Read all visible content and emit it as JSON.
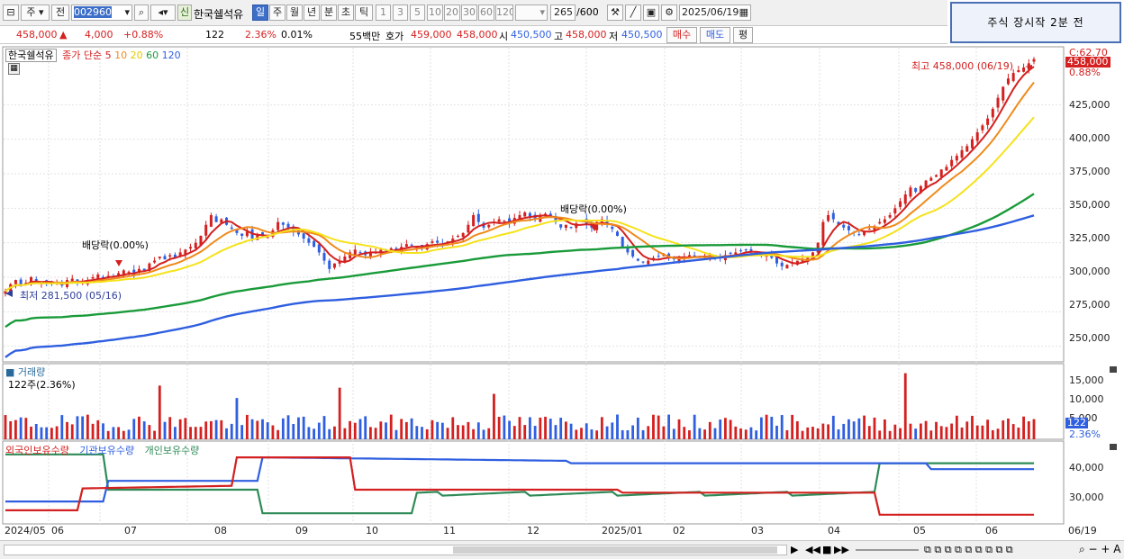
{
  "toolbar": {
    "type_label": "주",
    "jeon_label": "전",
    "code": "002960",
    "shin_badge": "신",
    "stock_name": "한국쉘석유",
    "periods": [
      "일",
      "주",
      "월",
      "년",
      "분",
      "초",
      "틱"
    ],
    "period_active": "일",
    "minute_steps": [
      "1",
      "3",
      "5",
      "10",
      "20",
      "30",
      "60",
      "120"
    ],
    "count": "265",
    "count_total": "/600",
    "date": "2025/06/19"
  },
  "notice": {
    "text": "주식 장시작  2분 전"
  },
  "quote": {
    "price": "458,000",
    "change_arrow": "▲",
    "change": "4,000",
    "change_pct": "+0.88%",
    "volume": "122",
    "volume_ratio": "2.36%",
    "turnover": "0.01%",
    "amount": "55백만",
    "hoga_label": "호가",
    "ask": "459,000",
    "bid": "458,000",
    "open_label": "시",
    "open": "450,500",
    "high_label": "고",
    "high": "458,000",
    "low_label": "저",
    "low": "450,500",
    "buy_label": "매수",
    "sell_label": "매도",
    "eval_label": "평"
  },
  "price_panel": {
    "legend_name": "한국쉘석유",
    "legend_ma": "종가 단순",
    "ma_periods": [
      "5",
      "10",
      "20",
      "60",
      "120"
    ],
    "ma_colors": [
      "#d42020",
      "#f08a1c",
      "#f5e21b",
      "#1a9b3a",
      "#2f5fe0"
    ],
    "yticks": [
      "425,000",
      "400,000",
      "375,000",
      "350,000",
      "325,000",
      "300,000",
      "275,000",
      "250,000"
    ],
    "last_price_box": "458,000",
    "last_pct_label": "0.88%",
    "top_label": "C:62.70",
    "high_annotation": "최고 458,000 (06/19)",
    "low_annotation": "최저 281,500 (05/16)",
    "dividend1": "배당락(0.00%)",
    "dividend2": "배당락(0.00%)"
  },
  "volume_panel": {
    "title": "거래량",
    "sub": "122주(2.36%)",
    "yticks": [
      "15,000",
      "10,000",
      "5,000"
    ],
    "last_box": "122",
    "last_pct": "2.36%"
  },
  "holding_panel": {
    "titles": [
      "외국인보유수량",
      "기관보유수량",
      "개인보유수량"
    ],
    "colors": [
      "#d42020",
      "#2f5fe0",
      "#2e8b57"
    ],
    "yticks": [
      "40,000",
      "30,000"
    ]
  },
  "xaxis": [
    "2024/05",
    "06",
    "07",
    "08",
    "09",
    "10",
    "11",
    "12",
    "2025/01",
    "02",
    "03",
    "04",
    "05",
    "06",
    "06/19"
  ],
  "chart_data": {
    "type": "line",
    "ylim": [
      240000,
      465000
    ],
    "high_point": {
      "date": "06/19",
      "value": 458000
    },
    "low_point": {
      "date": "05/16",
      "value": 281500
    },
    "close_series": [
      {
        "month": "2024/05",
        "values": [
          290000,
          295000,
          298000,
          294000,
          296000,
          300000,
          297000,
          296000,
          295000
        ]
      },
      {
        "month": "06",
        "values": [
          295000,
          296000,
          294000,
          298000,
          299000,
          297000,
          296000,
          298000,
          300000,
          302000,
          299000,
          301000,
          300000,
          303000,
          305000,
          304000
        ]
      },
      {
        "month": "07",
        "values": [
          302000,
          306000,
          305000,
          310000,
          312000,
          315000,
          313000,
          316000,
          314000,
          318000,
          320000,
          322000,
          325000,
          330000,
          338000,
          345000,
          340000
        ]
      },
      {
        "month": "08",
        "values": [
          342000,
          338000,
          335000,
          332000,
          330000,
          333000,
          328000,
          331000,
          330000,
          329000,
          334000,
          340000,
          338000,
          336000,
          333000,
          331000,
          328000
        ]
      },
      {
        "month": "09",
        "values": [
          325000,
          322000,
          318000,
          312000,
          306000,
          310000,
          312000,
          315000,
          318000,
          320000,
          318000,
          316000,
          318000
        ]
      },
      {
        "month": "10",
        "values": [
          318000,
          320000,
          319000,
          321000,
          320000,
          322000,
          324000,
          323000,
          322000,
          321000,
          324000,
          326000,
          325000,
          324000,
          326000,
          328000,
          330000
        ]
      },
      {
        "month": "11",
        "values": [
          332000,
          338000,
          345000,
          340000,
          336000,
          338000,
          340000,
          342000,
          341000,
          339000,
          343000,
          345000,
          347000,
          344000,
          342000,
          345000,
          346000
        ]
      },
      {
        "month": "12",
        "values": [
          344000,
          340000,
          336000,
          338000,
          336000,
          339000,
          341000,
          338000,
          336000,
          340000,
          342000,
          338000,
          335000
        ]
      },
      {
        "month": "2025/01",
        "values": [
          330000,
          322000,
          318000,
          315000,
          312000,
          311000,
          312000,
          314000,
          315000,
          316000,
          314000,
          313000,
          314000,
          315000,
          316000,
          315000
        ]
      },
      {
        "month": "02",
        "values": [
          314000,
          315000,
          316000,
          315000,
          314000,
          316000,
          317000,
          318000,
          319000,
          320000,
          318000,
          317000,
          316000,
          318000
        ]
      },
      {
        "month": "03",
        "values": [
          314000,
          310000,
          308000,
          309000,
          311000,
          312000,
          313000,
          314000,
          318000,
          325000,
          340000,
          345000,
          342000,
          338000,
          336000
        ]
      },
      {
        "month": "04",
        "values": [
          334000,
          332000,
          331000,
          333000,
          335000,
          337000,
          340000,
          342000,
          345000,
          350000,
          355000,
          360000,
          365000
        ]
      },
      {
        "month": "05",
        "values": [
          362000,
          366000,
          370000,
          372000,
          374000,
          378000,
          380000,
          385000,
          388000,
          392000,
          395000,
          400000,
          405000,
          410000
        ]
      },
      {
        "month": "06",
        "values": [
          415000,
          422000,
          430000,
          438000,
          444000,
          448000,
          450000,
          452000,
          455000,
          458000
        ]
      }
    ],
    "volume_highlights": [
      {
        "label": "peak",
        "value": 16000
      },
      {
        "label": "06/19",
        "value": 122
      }
    ]
  }
}
